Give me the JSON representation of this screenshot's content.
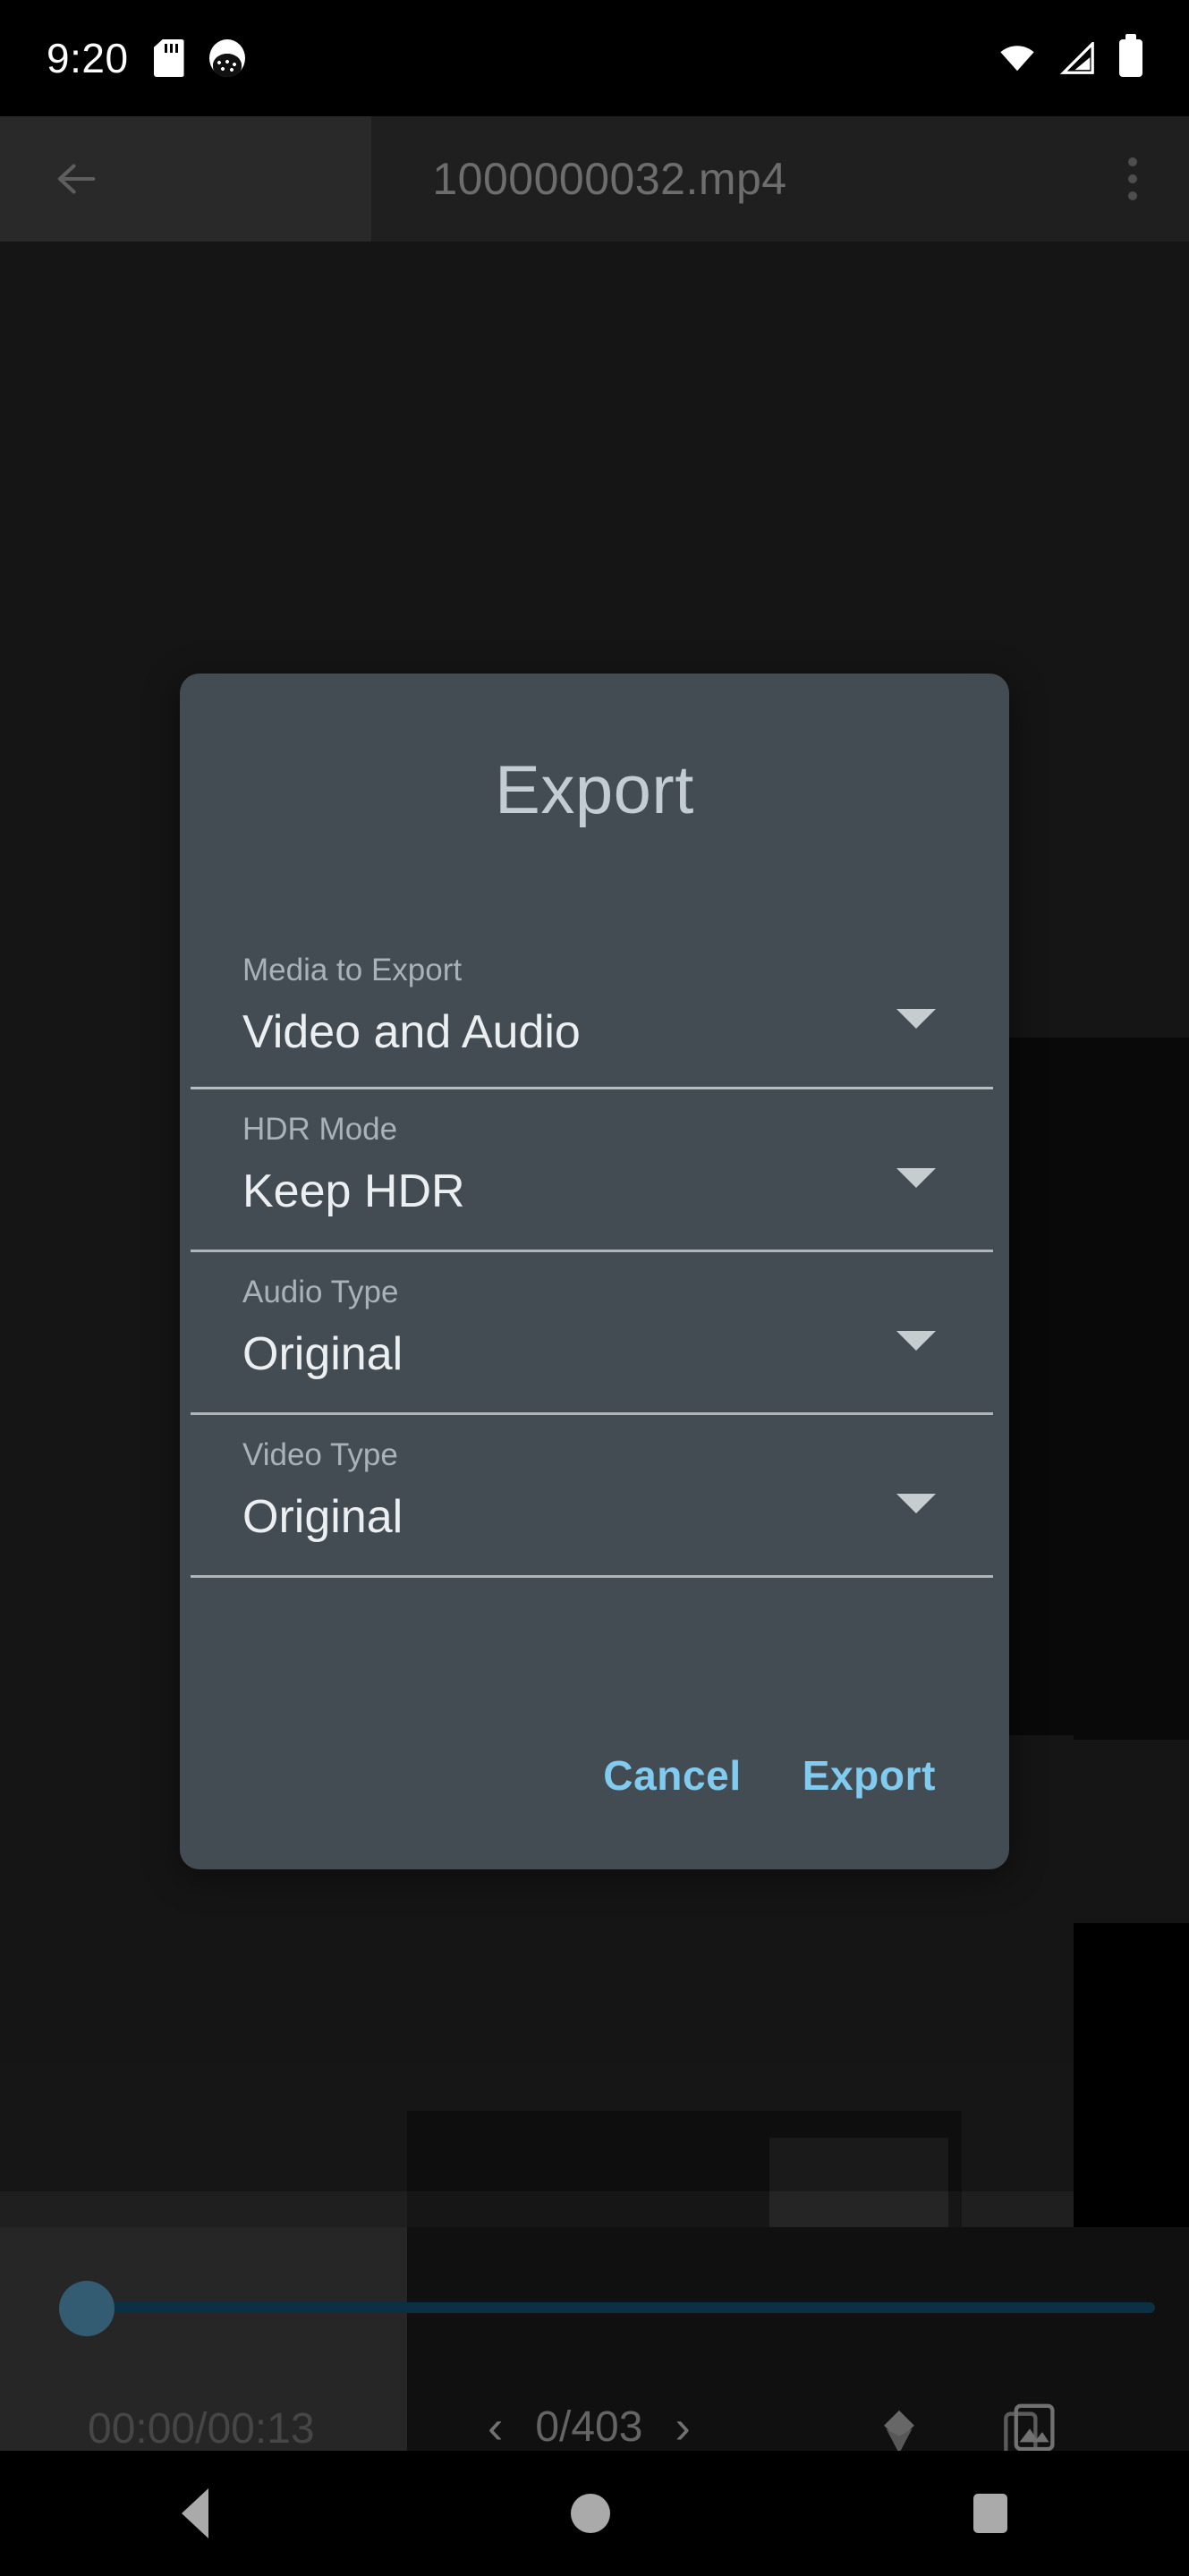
{
  "status_bar": {
    "clock": "9:20",
    "left_icons": [
      "sd-card-icon",
      "cat-notification-icon"
    ],
    "right_icons": [
      "wifi-icon",
      "cellular-signal-icon",
      "battery-icon"
    ]
  },
  "app": {
    "back_icon": "back-arrow-icon",
    "title": "1000000032.mp4",
    "overflow_icon": "overflow-menu-icon"
  },
  "player": {
    "timecode": "00:00/00:13",
    "prev_icon": "chevron-left-icon",
    "frame_counter": "0/403",
    "next_icon": "chevron-right-icon",
    "layers_icon": "layers-icon",
    "gallery_icon": "gallery-icon",
    "seek_position_percent": 0
  },
  "dialog": {
    "title": "Export",
    "fields": [
      {
        "label": "Media to Export",
        "value": "Video and Audio",
        "arrow_icon": "chevron-down-icon"
      },
      {
        "label": "HDR Mode",
        "value": "Keep HDR",
        "arrow_icon": "chevron-down-icon"
      },
      {
        "label": "Audio Type",
        "value": "Original",
        "arrow_icon": "chevron-down-icon"
      },
      {
        "label": "Video Type",
        "value": "Original",
        "arrow_icon": "chevron-down-icon"
      }
    ],
    "cancel_label": "Cancel",
    "export_label": "Export"
  },
  "nav_bar": {
    "back_icon": "nav-back-icon",
    "home_icon": "nav-home-icon",
    "recents_icon": "nav-recents-icon"
  },
  "colors": {
    "dialog_bg": "#434c52",
    "accent": "#82cbf0",
    "title_text": "#c3ccd2",
    "label_text": "#a9b2b8",
    "value_text": "#eceff1",
    "seek_track": "#0e3a52",
    "seek_thumb": "#3f6f8a",
    "screen_bg": "#000000"
  }
}
